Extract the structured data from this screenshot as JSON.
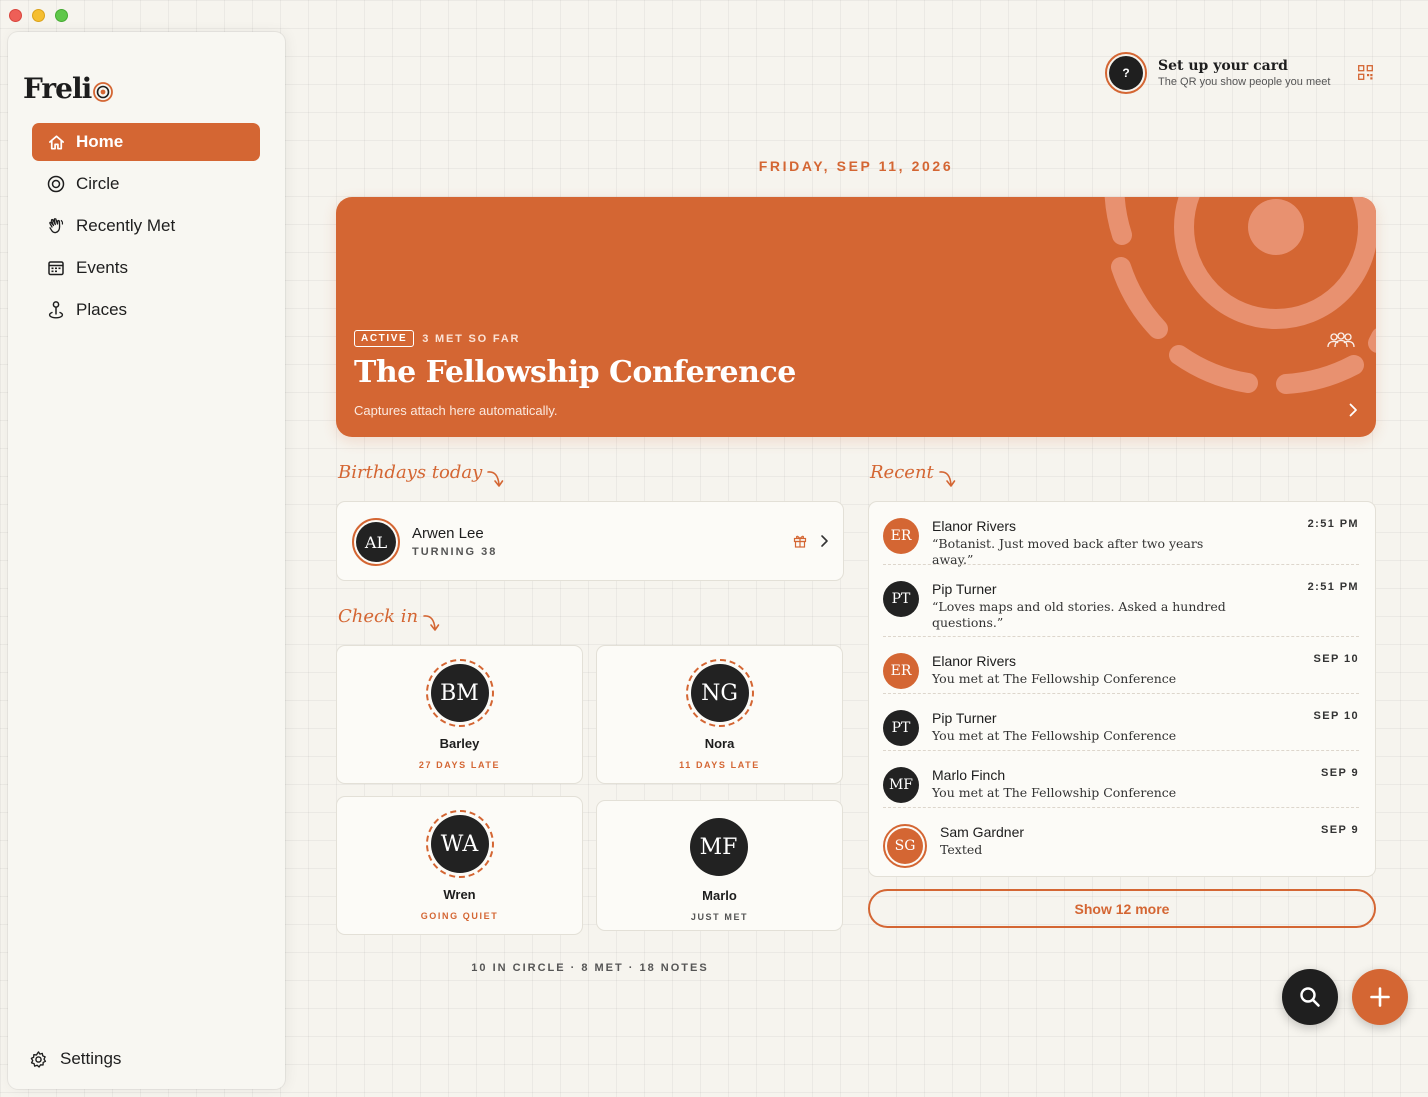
{
  "app": {
    "name": "Freli"
  },
  "sidebar": {
    "items": [
      {
        "label": "Home",
        "icon": "home-icon",
        "active": true
      },
      {
        "label": "Circle",
        "icon": "circle-icon"
      },
      {
        "label": "Recently Met",
        "icon": "wave-hand-icon"
      },
      {
        "label": "Events",
        "icon": "calendar-icon"
      },
      {
        "label": "Places",
        "icon": "pin-icon"
      }
    ],
    "settings_label": "Settings"
  },
  "card_setup": {
    "avatar": "?",
    "title": "Set up your card",
    "subtitle": "The QR you show people you meet"
  },
  "date": "FRIDAY, SEP 11, 2026",
  "event": {
    "status": "ACTIVE",
    "met_count": "3 MET SO FAR",
    "title": "The Fellowship Conference",
    "subtitle": "Captures attach here automatically."
  },
  "birthdays": {
    "heading": "Birthdays today",
    "items": [
      {
        "initials": "AL",
        "name": "Arwen Lee",
        "sub": "TURNING 38"
      }
    ]
  },
  "check_in": {
    "heading": "Check in",
    "items": [
      {
        "initials": "BM",
        "name": "Barley",
        "status": "27 DAYS LATE"
      },
      {
        "initials": "NG",
        "name": "Nora",
        "status": "11 DAYS LATE"
      },
      {
        "initials": "WA",
        "name": "Wren",
        "status": "GOING QUIET"
      },
      {
        "initials": "MF",
        "name": "Marlo",
        "status": "JUST MET"
      }
    ]
  },
  "stats": "10 IN CIRCLE · 8 MET · 18 NOTES",
  "recent": {
    "heading": "Recent",
    "items": [
      {
        "initials": "ER",
        "name": "Elanor Rivers",
        "note": "“Botanist. Just moved back after two years away.”",
        "time": "2:51 PM"
      },
      {
        "initials": "PT",
        "name": "Pip Turner",
        "note": "“Loves maps and old stories. Asked a hundred questions.”",
        "time": "2:51 PM"
      },
      {
        "initials": "ER",
        "name": "Elanor Rivers",
        "note": "You met at The Fellowship Conference",
        "time": "SEP 10"
      },
      {
        "initials": "PT",
        "name": "Pip Turner",
        "note": "You met at The Fellowship Conference",
        "time": "SEP 10"
      },
      {
        "initials": "MF",
        "name": "Marlo Finch",
        "note": "You met at The Fellowship Conference",
        "time": "SEP 9"
      },
      {
        "initials": "SG",
        "name": "Sam Gardner",
        "note": "Texted",
        "time": "SEP 9"
      }
    ],
    "show_more": "Show 12 more"
  },
  "colors": {
    "accent": "#d46633",
    "dark": "#1f1f1f",
    "background": "#f6f4ee"
  }
}
